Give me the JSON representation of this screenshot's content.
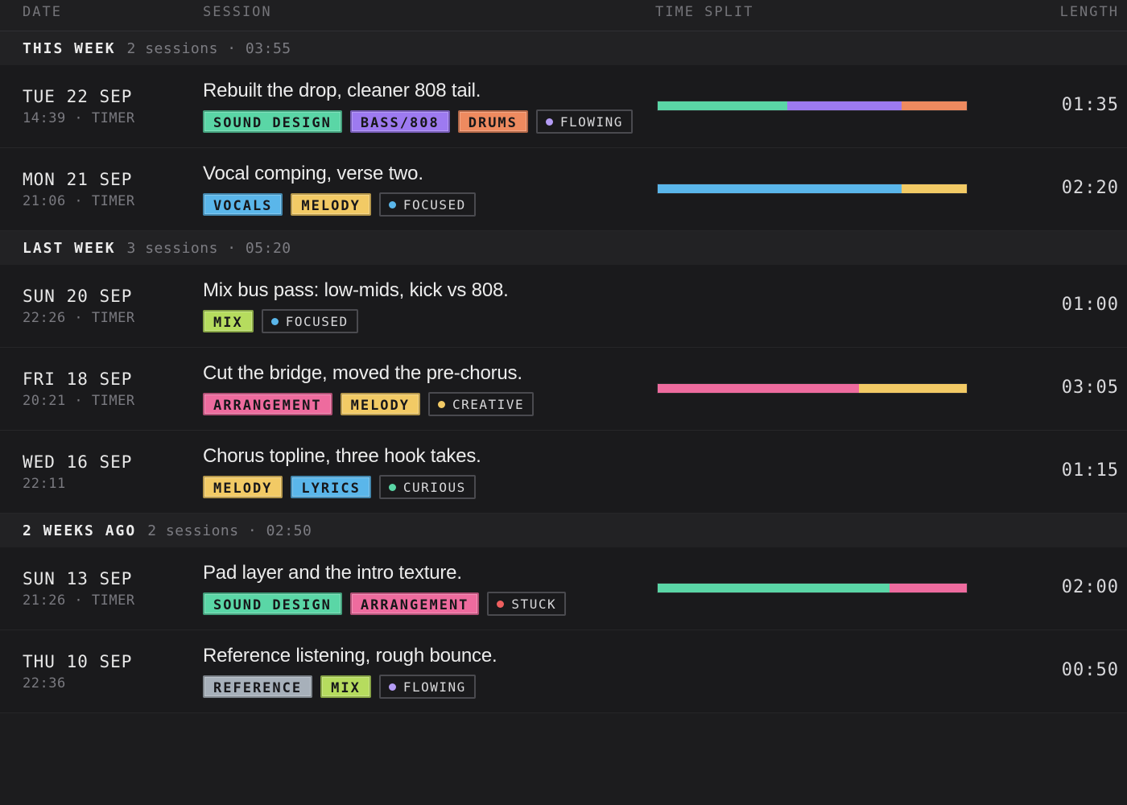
{
  "header": {
    "date": "DATE",
    "session": "SESSION",
    "time_split": "TIME SPLIT",
    "length": "LENGTH"
  },
  "colors": {
    "sound_design": "#5ad6a6",
    "bass808": "#9d7af0",
    "drums": "#ee8a5f",
    "vocals": "#5ab6ea",
    "melody": "#f2ca65",
    "mix": "#b6dc5e",
    "arrangement": "#ee6b9e",
    "lyrics": "#5ab6ea",
    "reference": "#a7b0ba"
  },
  "groups": [
    {
      "title": "THIS WEEK",
      "meta": "2 sessions · 03:55",
      "rows": [
        {
          "date": "TUE 22 SEP",
          "sub": "14:39 · TIMER",
          "title": "Rebuilt the drop, cleaner 808 tail.",
          "tags": [
            {
              "label": "SOUND DESIGN",
              "color": "#5ad6a6"
            },
            {
              "label": "BASS/808",
              "color": "#9d7af0"
            },
            {
              "label": "DRUMS",
              "color": "#ee8a5f"
            }
          ],
          "mood": {
            "label": "FLOWING",
            "color": "#b49cf5"
          },
          "split": [
            {
              "color": "#5ad6a6",
              "fraction": 0.42
            },
            {
              "color": "#9d7af0",
              "fraction": 0.37
            },
            {
              "color": "#ee8a5f",
              "fraction": 0.21
            }
          ],
          "length": "01:35"
        },
        {
          "date": "MON 21 SEP",
          "sub": "21:06 · TIMER",
          "title": "Vocal comping, verse two.",
          "tags": [
            {
              "label": "VOCALS",
              "color": "#5ab6ea"
            },
            {
              "label": "MELODY",
              "color": "#f2ca65"
            }
          ],
          "mood": {
            "label": "FOCUSED",
            "color": "#5ab6ea"
          },
          "split": [
            {
              "color": "#5ab6ea",
              "fraction": 0.79
            },
            {
              "color": "#f2ca65",
              "fraction": 0.21
            }
          ],
          "length": "02:20"
        }
      ]
    },
    {
      "title": "LAST WEEK",
      "meta": "3 sessions · 05:20",
      "rows": [
        {
          "date": "SUN 20 SEP",
          "sub": "22:26 · TIMER",
          "title": "Mix bus pass: low-mids, kick vs 808.",
          "tags": [
            {
              "label": "MIX",
              "color": "#b6dc5e"
            }
          ],
          "mood": {
            "label": "FOCUSED",
            "color": "#5ab6ea"
          },
          "split": [],
          "length": "01:00"
        },
        {
          "date": "FRI 18 SEP",
          "sub": "20:21 · TIMER",
          "title": "Cut the bridge, moved the pre-chorus.",
          "tags": [
            {
              "label": "ARRANGEMENT",
              "color": "#ee6b9e"
            },
            {
              "label": "MELODY",
              "color": "#f2ca65"
            }
          ],
          "mood": {
            "label": "CREATIVE",
            "color": "#f2ca65"
          },
          "split": [
            {
              "color": "#ee6b9e",
              "fraction": 0.65
            },
            {
              "color": "#f2ca65",
              "fraction": 0.35
            }
          ],
          "length": "03:05"
        },
        {
          "date": "WED 16 SEP",
          "sub": "22:11",
          "title": "Chorus topline, three hook takes.",
          "tags": [
            {
              "label": "MELODY",
              "color": "#f2ca65"
            },
            {
              "label": "LYRICS",
              "color": "#5ab6ea"
            }
          ],
          "mood": {
            "label": "CURIOUS",
            "color": "#5ad6a6"
          },
          "split": [],
          "length": "01:15"
        }
      ]
    },
    {
      "title": "2 WEEKS AGO",
      "meta": "2 sessions · 02:50",
      "rows": [
        {
          "date": "SUN 13 SEP",
          "sub": "21:26 · TIMER",
          "title": "Pad layer and the intro texture.",
          "tags": [
            {
              "label": "SOUND DESIGN",
              "color": "#5ad6a6"
            },
            {
              "label": "ARRANGEMENT",
              "color": "#ee6b9e"
            }
          ],
          "mood": {
            "label": "STUCK",
            "color": "#ef5f5f"
          },
          "split": [
            {
              "color": "#5ad6a6",
              "fraction": 0.75
            },
            {
              "color": "#ee6b9e",
              "fraction": 0.25
            }
          ],
          "length": "02:00"
        },
        {
          "date": "THU 10 SEP",
          "sub": "22:36",
          "title": "Reference listening, rough bounce.",
          "tags": [
            {
              "label": "REFERENCE",
              "color": "#a7b0ba"
            },
            {
              "label": "MIX",
              "color": "#b6dc5e"
            }
          ],
          "mood": {
            "label": "FLOWING",
            "color": "#b49cf5"
          },
          "split": [],
          "length": "00:50"
        }
      ]
    }
  ]
}
